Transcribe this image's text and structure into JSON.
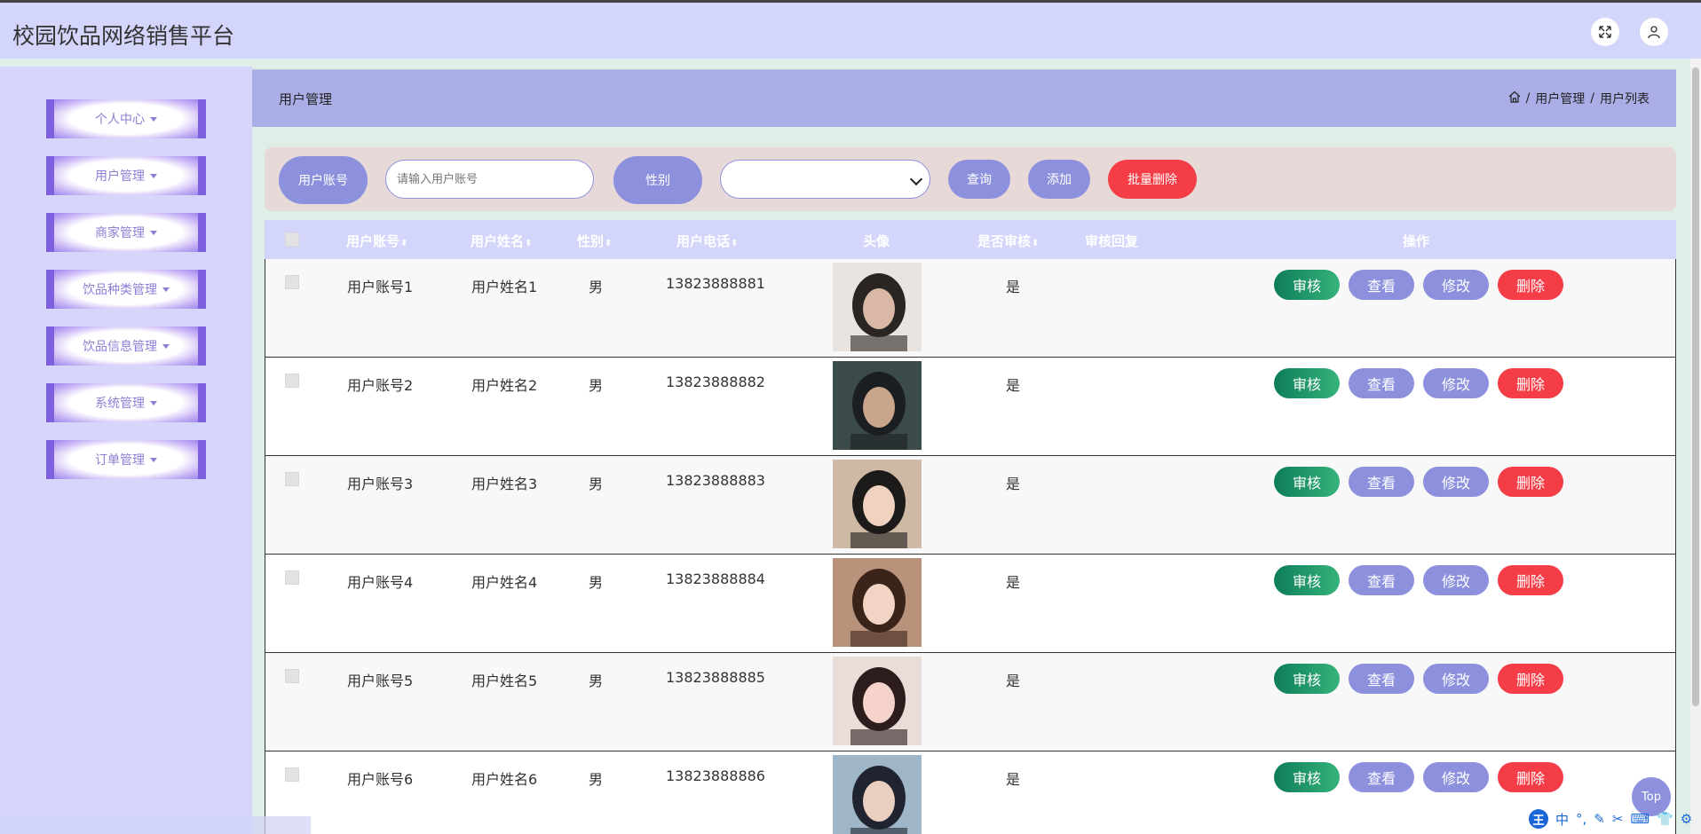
{
  "app": {
    "title": "校园饮品网络销售平台"
  },
  "sidebar": {
    "items": [
      {
        "label": "个人中心"
      },
      {
        "label": "用户管理"
      },
      {
        "label": "商家管理"
      },
      {
        "label": "饮品种类管理"
      },
      {
        "label": "饮品信息管理"
      },
      {
        "label": "系统管理"
      },
      {
        "label": "订单管理"
      }
    ]
  },
  "header": {
    "title": "用户管理",
    "breadcrumb": [
      "用户管理",
      "用户列表"
    ],
    "separator": "/"
  },
  "search": {
    "account_label": "用户账号",
    "account_placeholder": "请输入用户账号",
    "gender_label": "性别",
    "gender_selected": "",
    "query_label": "查询",
    "add_label": "添加",
    "batch_delete_label": "批量删除"
  },
  "table": {
    "headers": {
      "account": "用户账号",
      "name": "用户姓名",
      "gender": "性别",
      "phone": "用户电话",
      "avatar": "头像",
      "reviewed": "是否审核",
      "reply": "审核回复",
      "actions": "操作"
    },
    "sort_glyph": "⬍",
    "action_labels": {
      "audit": "审核",
      "view": "查看",
      "edit": "修改",
      "delete": "删除"
    },
    "rows": [
      {
        "account": "用户账号1",
        "name": "用户姓名1",
        "gender": "男",
        "phone": "13823888881",
        "reviewed": "是",
        "reply": "",
        "avatar_colors": [
          "#e9e4df",
          "#2a2522",
          "#d9b8a6"
        ]
      },
      {
        "account": "用户账号2",
        "name": "用户姓名2",
        "gender": "男",
        "phone": "13823888882",
        "reviewed": "是",
        "reply": "",
        "avatar_colors": [
          "#3b4a4a",
          "#1c1f22",
          "#c9a58c"
        ]
      },
      {
        "account": "用户账号3",
        "name": "用户姓名3",
        "gender": "男",
        "phone": "13823888883",
        "reviewed": "是",
        "reply": "",
        "avatar_colors": [
          "#cdb9a4",
          "#1d1a1a",
          "#f0d2c0"
        ]
      },
      {
        "account": "用户账号4",
        "name": "用户姓名4",
        "gender": "男",
        "phone": "13823888884",
        "reviewed": "是",
        "reply": "",
        "avatar_colors": [
          "#b8927a",
          "#3a2419",
          "#f2d4c4"
        ]
      },
      {
        "account": "用户账号5",
        "name": "用户姓名5",
        "gender": "男",
        "phone": "13823888885",
        "reviewed": "是",
        "reply": "",
        "avatar_colors": [
          "#e8ddd8",
          "#2c1d1c",
          "#f5d3cb"
        ]
      },
      {
        "account": "用户账号6",
        "name": "用户姓名6",
        "gender": "男",
        "phone": "13823888886",
        "reviewed": "是",
        "reply": "",
        "avatar_colors": [
          "#9fb6c9",
          "#1f2430",
          "#e9cfbf"
        ]
      }
    ]
  },
  "misc": {
    "top_label": "Top",
    "ime_text": "中"
  },
  "colors": {
    "accent": "#8c90dd",
    "danger": "#f43d47",
    "audit": "#1f9b6a",
    "topbar": "#d4d5fb",
    "sidebar": "#d6d6fb"
  }
}
